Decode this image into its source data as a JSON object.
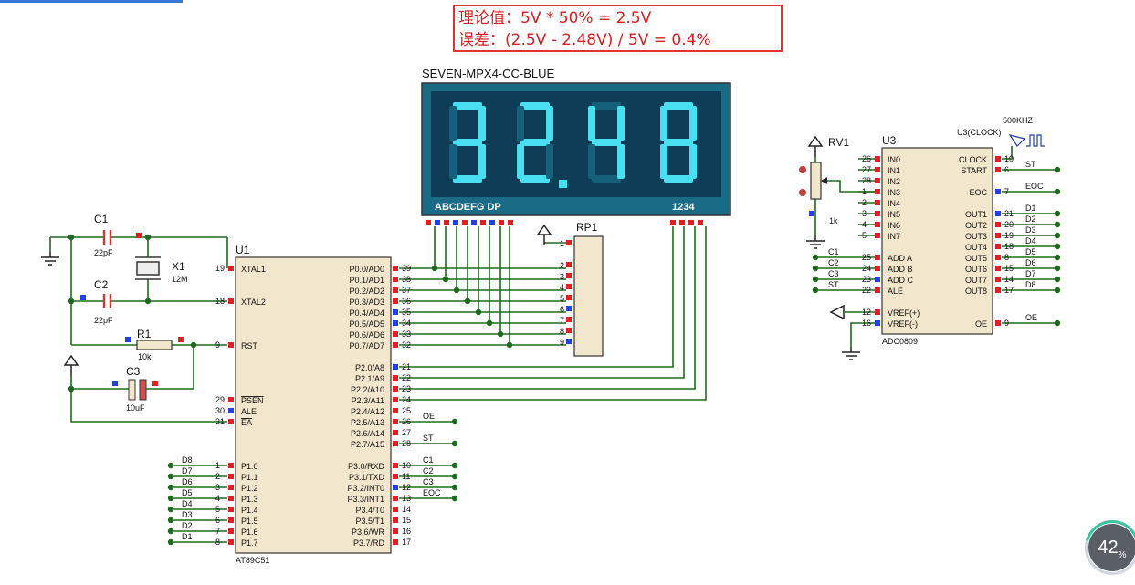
{
  "note": {
    "line1": "理论值：5V * 50% = 2.5V",
    "line2": "误差：(2.5V - 2.48V) / 5V = 0.4%"
  },
  "display": {
    "title": "SEVEN-MPX4-CC-BLUE",
    "digits": [
      "3",
      "2",
      "4",
      "8"
    ],
    "dp_after": 1,
    "seg_label": "ABCDEFG DP",
    "digit_label": "1234",
    "bg": "#1a6b86",
    "lit": "#48e0f0",
    "dim": "#15607a"
  },
  "rp1": {
    "ref": "RP1",
    "pins": [
      "1",
      "2",
      "3",
      "4",
      "5",
      "6",
      "7",
      "8",
      "9"
    ]
  },
  "u1": {
    "ref": "U1",
    "part": "AT89C51",
    "left_pins": [
      {
        "num": "19",
        "name": "XTAL1"
      },
      {
        "num": "18",
        "name": "XTAL2"
      },
      {
        "num": "9",
        "name": "RST"
      },
      {
        "num": "29",
        "name": "PSEN"
      },
      {
        "num": "30",
        "name": "ALE"
      },
      {
        "num": "31",
        "name": "EA"
      },
      {
        "num": "1",
        "name": "P1.0"
      },
      {
        "num": "2",
        "name": "P1.1"
      },
      {
        "num": "3",
        "name": "P1.2"
      },
      {
        "num": "4",
        "name": "P1.3"
      },
      {
        "num": "5",
        "name": "P1.4"
      },
      {
        "num": "6",
        "name": "P1.5"
      },
      {
        "num": "7",
        "name": "P1.6"
      },
      {
        "num": "8",
        "name": "P1.7"
      }
    ],
    "right_pins": [
      {
        "num": "39",
        "name": "P0.0/AD0"
      },
      {
        "num": "38",
        "name": "P0.1/AD1"
      },
      {
        "num": "37",
        "name": "P0.2/AD2"
      },
      {
        "num": "36",
        "name": "P0.3/AD3"
      },
      {
        "num": "35",
        "name": "P0.4/AD4"
      },
      {
        "num": "34",
        "name": "P0.5/AD5"
      },
      {
        "num": "33",
        "name": "P0.6/AD6"
      },
      {
        "num": "32",
        "name": "P0.7/AD7"
      },
      {
        "num": "21",
        "name": "P2.0/A8"
      },
      {
        "num": "22",
        "name": "P2.1/A9"
      },
      {
        "num": "23",
        "name": "P2.2/A10"
      },
      {
        "num": "24",
        "name": "P2.3/A11"
      },
      {
        "num": "25",
        "name": "P2.4/A12"
      },
      {
        "num": "26",
        "name": "P2.5/A13"
      },
      {
        "num": "27",
        "name": "P2.6/A14"
      },
      {
        "num": "28",
        "name": "P2.7/A15"
      },
      {
        "num": "10",
        "name": "P3.0/RXD"
      },
      {
        "num": "11",
        "name": "P3.1/TXD"
      },
      {
        "num": "12",
        "name": "P3.2/INT0"
      },
      {
        "num": "13",
        "name": "P3.3/INT1"
      },
      {
        "num": "14",
        "name": "P3.4/T0"
      },
      {
        "num": "15",
        "name": "P3.5/T1"
      },
      {
        "num": "16",
        "name": "P3.6/WR"
      },
      {
        "num": "17",
        "name": "P3.7/RD"
      }
    ],
    "p1_labels": [
      "D8",
      "D7",
      "D6",
      "D5",
      "D4",
      "D3",
      "D2",
      "D1"
    ],
    "net_oe": "OE",
    "net_st": "ST",
    "p3_labels": [
      "C1",
      "C2",
      "C3",
      "EOC"
    ]
  },
  "u3": {
    "ref": "U3",
    "part": "ADC0809",
    "left_pins": [
      {
        "num": "26",
        "name": "IN0"
      },
      {
        "num": "27",
        "name": "IN1"
      },
      {
        "num": "28",
        "name": "IN2"
      },
      {
        "num": "1",
        "name": "IN3"
      },
      {
        "num": "2",
        "name": "IN4"
      },
      {
        "num": "3",
        "name": "IN5"
      },
      {
        "num": "4",
        "name": "IN6"
      },
      {
        "num": "5",
        "name": "IN7"
      },
      {
        "num": "25",
        "name": "ADD A"
      },
      {
        "num": "24",
        "name": "ADD B"
      },
      {
        "num": "23",
        "name": "ADD C"
      },
      {
        "num": "22",
        "name": "ALE"
      },
      {
        "num": "12",
        "name": "VREF(+)"
      },
      {
        "num": "16",
        "name": "VREF(-)"
      }
    ],
    "right_pins": [
      {
        "num": "10",
        "name": "CLOCK"
      },
      {
        "num": "6",
        "name": "START"
      },
      {
        "num": "7",
        "name": "EOC"
      },
      {
        "num": "21",
        "name": "OUT1"
      },
      {
        "num": "20",
        "name": "OUT2"
      },
      {
        "num": "19",
        "name": "OUT3"
      },
      {
        "num": "18",
        "name": "OUT4"
      },
      {
        "num": "8",
        "name": "OUT5"
      },
      {
        "num": "15",
        "name": "OUT6"
      },
      {
        "num": "14",
        "name": "OUT7"
      },
      {
        "num": "17",
        "name": "OUT8"
      },
      {
        "num": "9",
        "name": "OE"
      }
    ],
    "addr_labels": [
      "C1",
      "C2",
      "C3",
      "ST"
    ],
    "right_labels": [
      "ST",
      "EOC",
      "D1",
      "D2",
      "D3",
      "D4",
      "D5",
      "D6",
      "D7",
      "D8",
      "OE"
    ],
    "clock_ref": "U3(CLOCK)",
    "clock_freq": "500KHZ"
  },
  "rv1": {
    "ref": "RV1",
    "value": "1k"
  },
  "c1": {
    "ref": "C1",
    "value": "22pF"
  },
  "c2": {
    "ref": "C2",
    "value": "22pF"
  },
  "x1": {
    "ref": "X1",
    "value": "12M"
  },
  "r1": {
    "ref": "R1",
    "value": "10k"
  },
  "c3": {
    "ref": "C3",
    "value": "10uF"
  },
  "zoom": {
    "value": "42",
    "unit": "%"
  }
}
